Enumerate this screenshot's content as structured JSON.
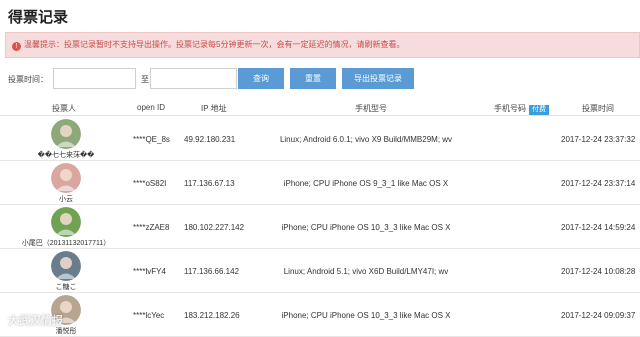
{
  "page": {
    "title": "得票记录"
  },
  "notice": {
    "icon": "warning-circle-icon",
    "text": "温馨提示：投票记录暂时不支持导出操作。投票记录每5分钟更新一次，会有一定延迟的情况，请刷新查看。"
  },
  "filter": {
    "label": "投票时间：",
    "to_label": "至",
    "start_placeholder": "",
    "end_placeholder": "",
    "query_label": "查询",
    "reset_label": "重置",
    "export_label": "导出投票记录"
  },
  "table": {
    "columns": {
      "voter": "投票人",
      "openid": "open ID",
      "ip": "IP 地址",
      "model": "手机型号",
      "phone": "手机号码",
      "paid_badge": "付费",
      "time": "投票时间"
    },
    "rows": [
      {
        "nickname": "��七七来莯��",
        "openid": "****QE_8s",
        "ip": "49.92.180.231",
        "model": "Linux; Android 6.0.1; vivo X9 Build/MMB29M; wv",
        "phone": "",
        "time": "2017-12-24 23:37:32",
        "avatar_color": "#8fa87a"
      },
      {
        "nickname": "小云",
        "openid": "****oS82I",
        "ip": "117.136.67.13",
        "model": "iPhone; CPU iPhone OS 9_3_1 like Mac OS X",
        "phone": "",
        "time": "2017-12-24 23:37:14",
        "avatar_color": "#d9a7a0"
      },
      {
        "nickname": "小尾巴（20131132017711）",
        "openid": "****zZAE8",
        "ip": "180.102.227.142",
        "model": "iPhone; CPU iPhone OS 10_3_3 like Mac OS X",
        "phone": "",
        "time": "2017-12-24 14:59:24",
        "avatar_color": "#6fa352"
      },
      {
        "nickname": "こ糖こ",
        "openid": "****lvFY4",
        "ip": "117.136.66.142",
        "model": "Linux; Android 5.1; vivo X6D Build/LMY47I; wv",
        "phone": "",
        "time": "2017-12-24 10:08:28",
        "avatar_color": "#6a7d8c"
      },
      {
        "nickname": "潘悦彤",
        "openid": "****lcYec",
        "ip": "183.212.182.26",
        "model": "iPhone; CPU iPhone OS 10_3_3 like Mac OS X",
        "phone": "",
        "time": "2017-12-24 09:09:37",
        "avatar_color": "#b8a590"
      }
    ]
  },
  "watermark": "大武汉情报"
}
